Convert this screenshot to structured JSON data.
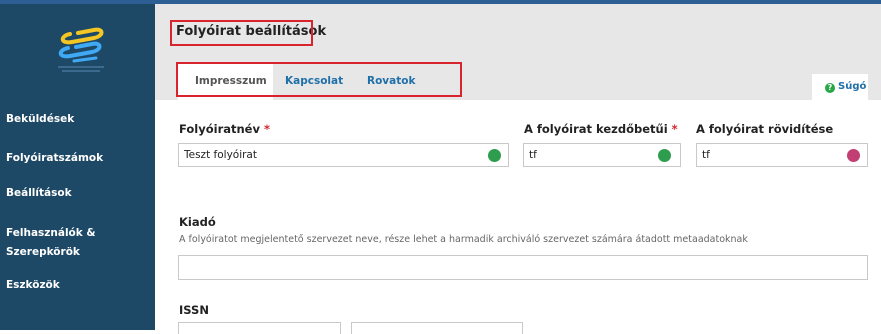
{
  "sidebar": {
    "items": [
      {
        "label": "Beküldések"
      },
      {
        "label": "Folyóiratszámok"
      },
      {
        "label": "Beállítások"
      },
      {
        "label": "Felhasználók &"
      },
      {
        "label": "Szerepkörök"
      },
      {
        "label": "Eszközök"
      }
    ]
  },
  "header": {
    "title": "Folyóirat beállítások",
    "tabs": [
      "Impresszum",
      "Kapcsolat",
      "Rovatok"
    ],
    "help_label": "Súgó",
    "help_icon_glyph": "?"
  },
  "form": {
    "journal_name": {
      "label": "Folyóiratnév",
      "required_mark": "*",
      "value": "Teszt folyóirat"
    },
    "initials": {
      "label": "A folyóirat kezdőbetűi",
      "required_mark": "*",
      "value": "tf"
    },
    "abbreviation": {
      "label": "A folyóirat rövidítése",
      "value": "tf"
    },
    "publisher": {
      "label": "Kiadó",
      "description": "A folyóiratot megjelentető szervezet neve, része lehet a harmadik archiváló szervezet számára átadott metaadatoknak",
      "value": ""
    },
    "issn": {
      "label": "ISSN"
    }
  },
  "colors": {
    "sidebar_bg": "#1e4966",
    "highlight_border": "#d8242c",
    "tab_link": "#1f6fa8",
    "globe_green": "#2e9d4e",
    "globe_pink": "#c13f73"
  }
}
